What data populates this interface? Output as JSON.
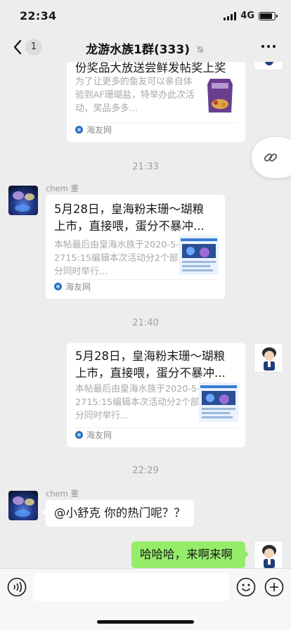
{
  "status": {
    "time": "22:34",
    "network": "4G"
  },
  "nav": {
    "unread": "1",
    "title": "龙游水族1群(333)"
  },
  "messages": {
    "card0": {
      "title": "份奖品大放送尝鲜发帖奖上奖",
      "desc": "为了让更多的鱼友可以亲自体验到AF珊瑚盐，特举办此次活动，奖品多多...",
      "source": "海友网"
    },
    "time1": "21:33",
    "card1": {
      "sender": "chem 董",
      "title_line1": "5月28日，皇海粉末珊～瑚粮",
      "title_line2": "上市，直接喂，蛋分不暴冲...",
      "desc": "本帖最后由皇海水族于2020-5-2715:15编辑本次活动分2个部分同时举行...",
      "source": "海友网"
    },
    "time2": "21:40",
    "card2": {
      "title_line1": "5月28日，皇海粉末珊～瑚粮",
      "title_line2": "上市，直接喂，蛋分不暴冲...",
      "desc": "本帖最后由皇海水族于2020-5-2715:15编辑本次活动分2个部分同时举行...",
      "source": "海友网"
    },
    "time3": "22:29",
    "text1": {
      "sender": "chem 董",
      "text": "@小舒克 你的热门呢？？"
    },
    "text2": {
      "text": "哈哈哈，来啊来啊"
    }
  },
  "icons": {
    "back": "back-icon",
    "mute": "mute-bell-icon",
    "more": "more-icon",
    "link": "link-icon",
    "voice": "voice-icon",
    "emoji": "emoji-icon",
    "plus": "plus-icon"
  },
  "colors": {
    "background": "#ededed",
    "bubble_out": "#95ec69",
    "bubble_in": "#ffffff"
  }
}
